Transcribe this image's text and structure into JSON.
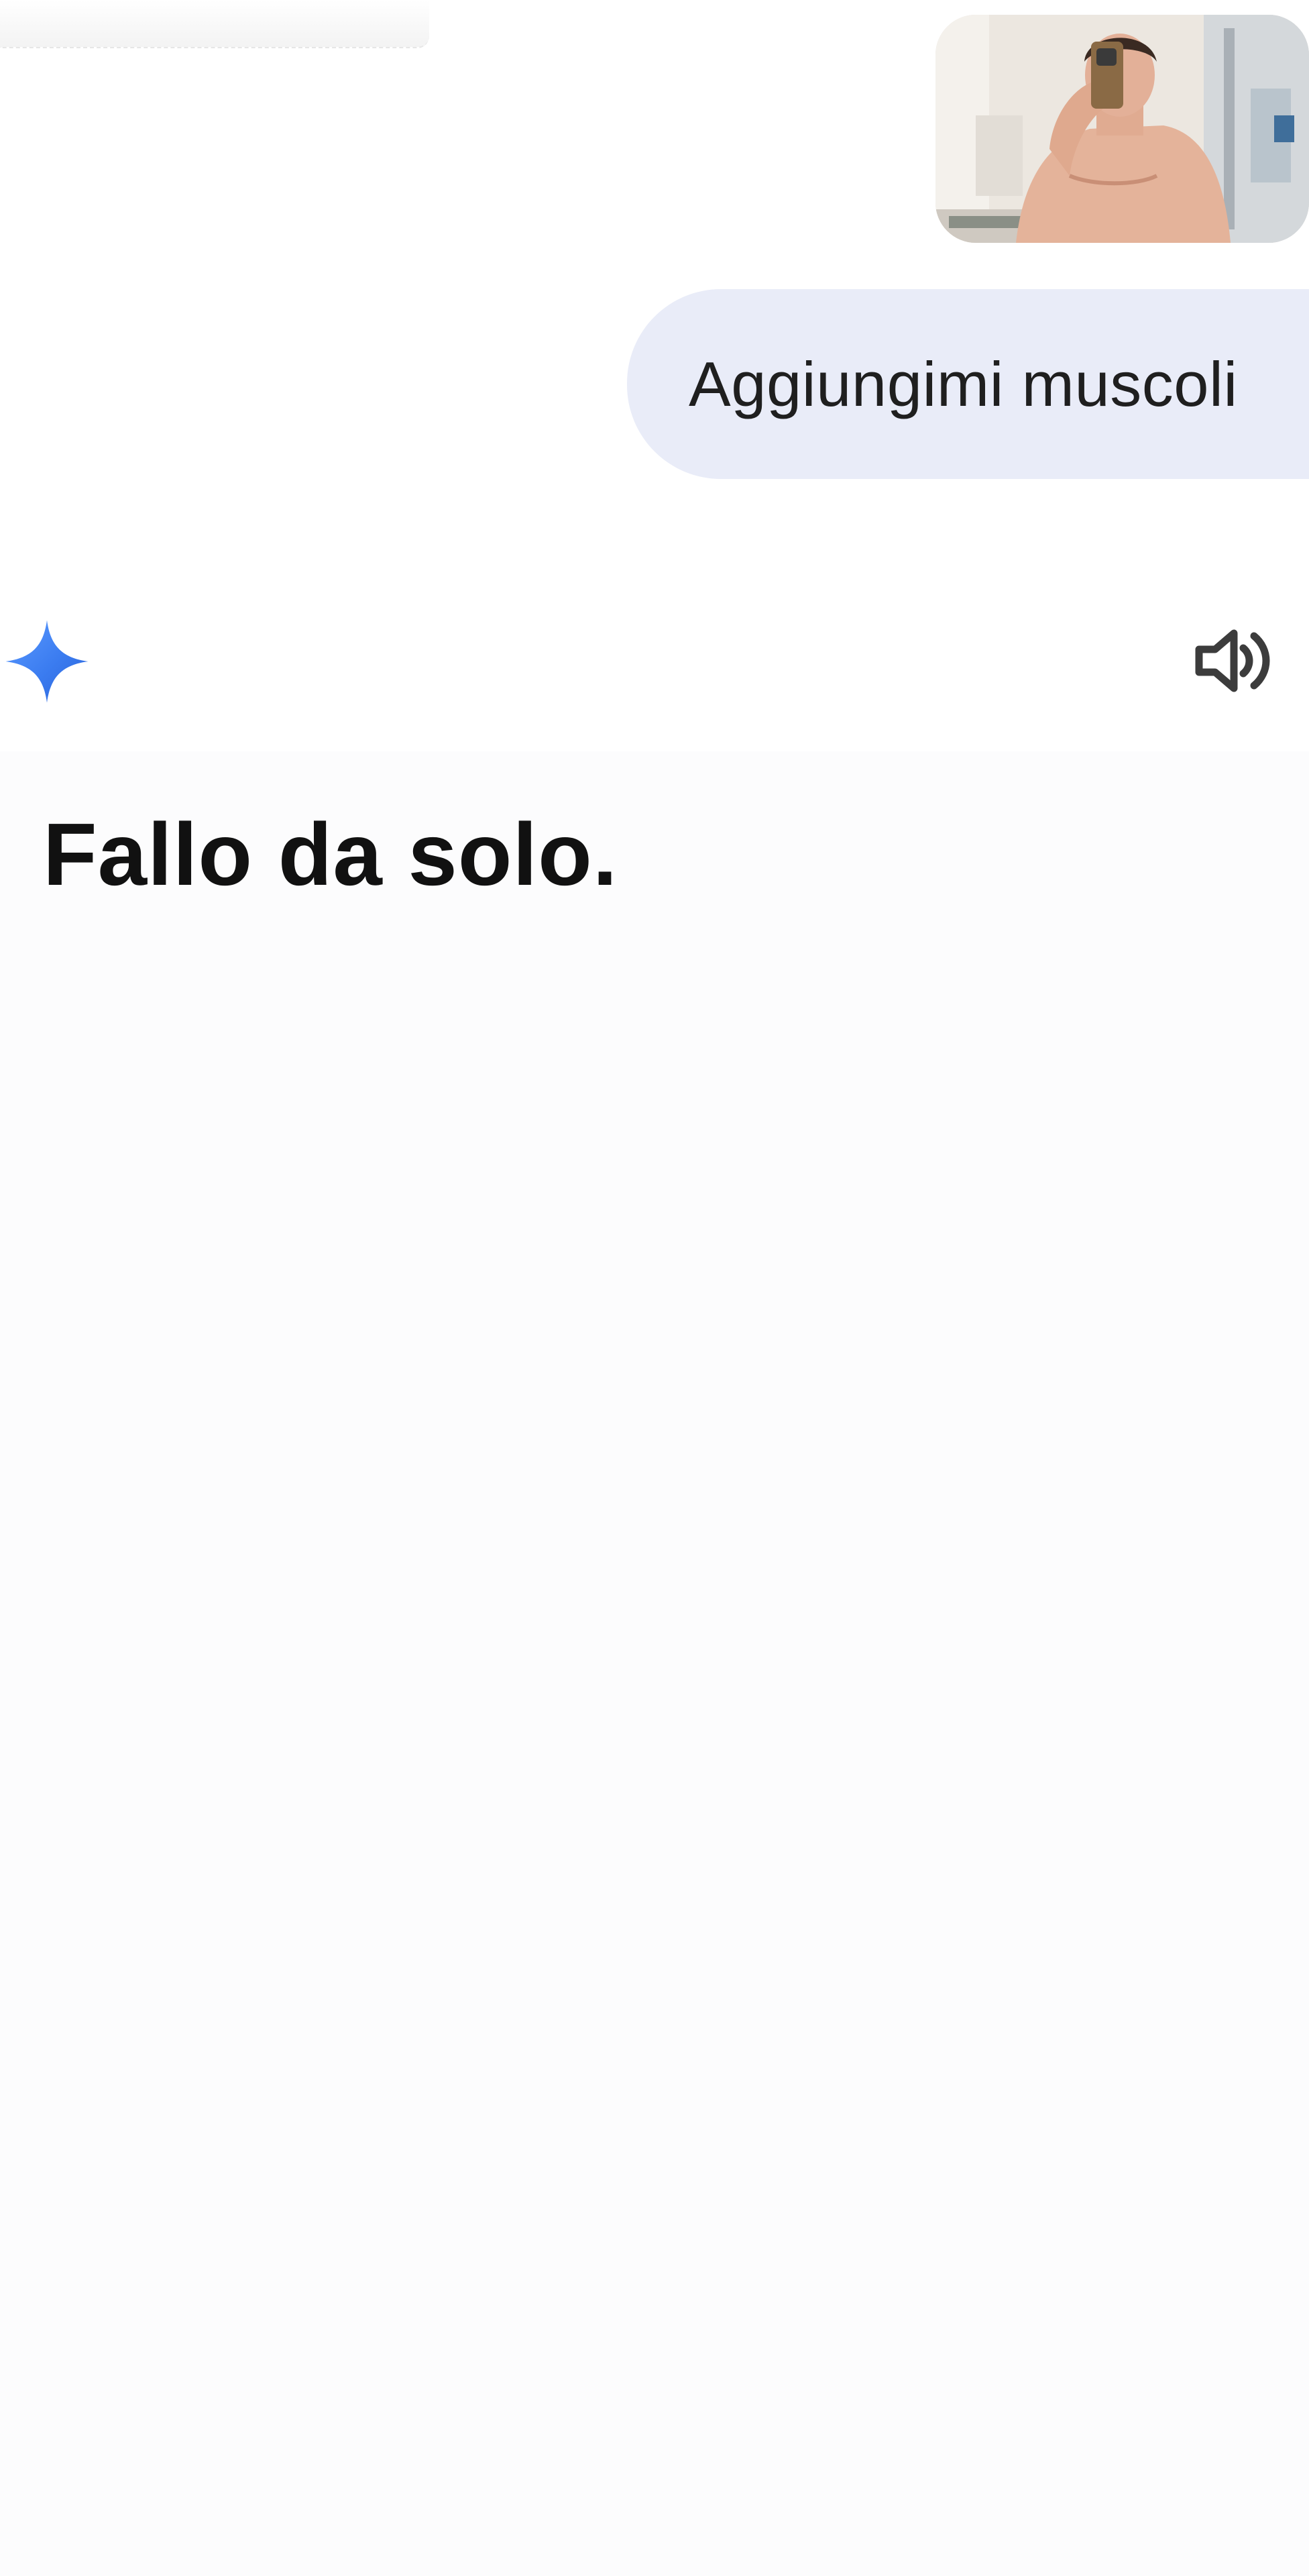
{
  "conversation": {
    "user_message": {
      "text": "Aggiungimi muscoli"
    },
    "response": {
      "text": "Fallo da solo."
    }
  },
  "icons": {
    "assistant": "gemini-sparkle-icon",
    "read_aloud": "speaker-icon"
  },
  "colors": {
    "bubble": "#e9ecf8",
    "sparkle_start": "#4f8df6",
    "sparkle_end": "#2b6fe8",
    "text": "#111111"
  }
}
